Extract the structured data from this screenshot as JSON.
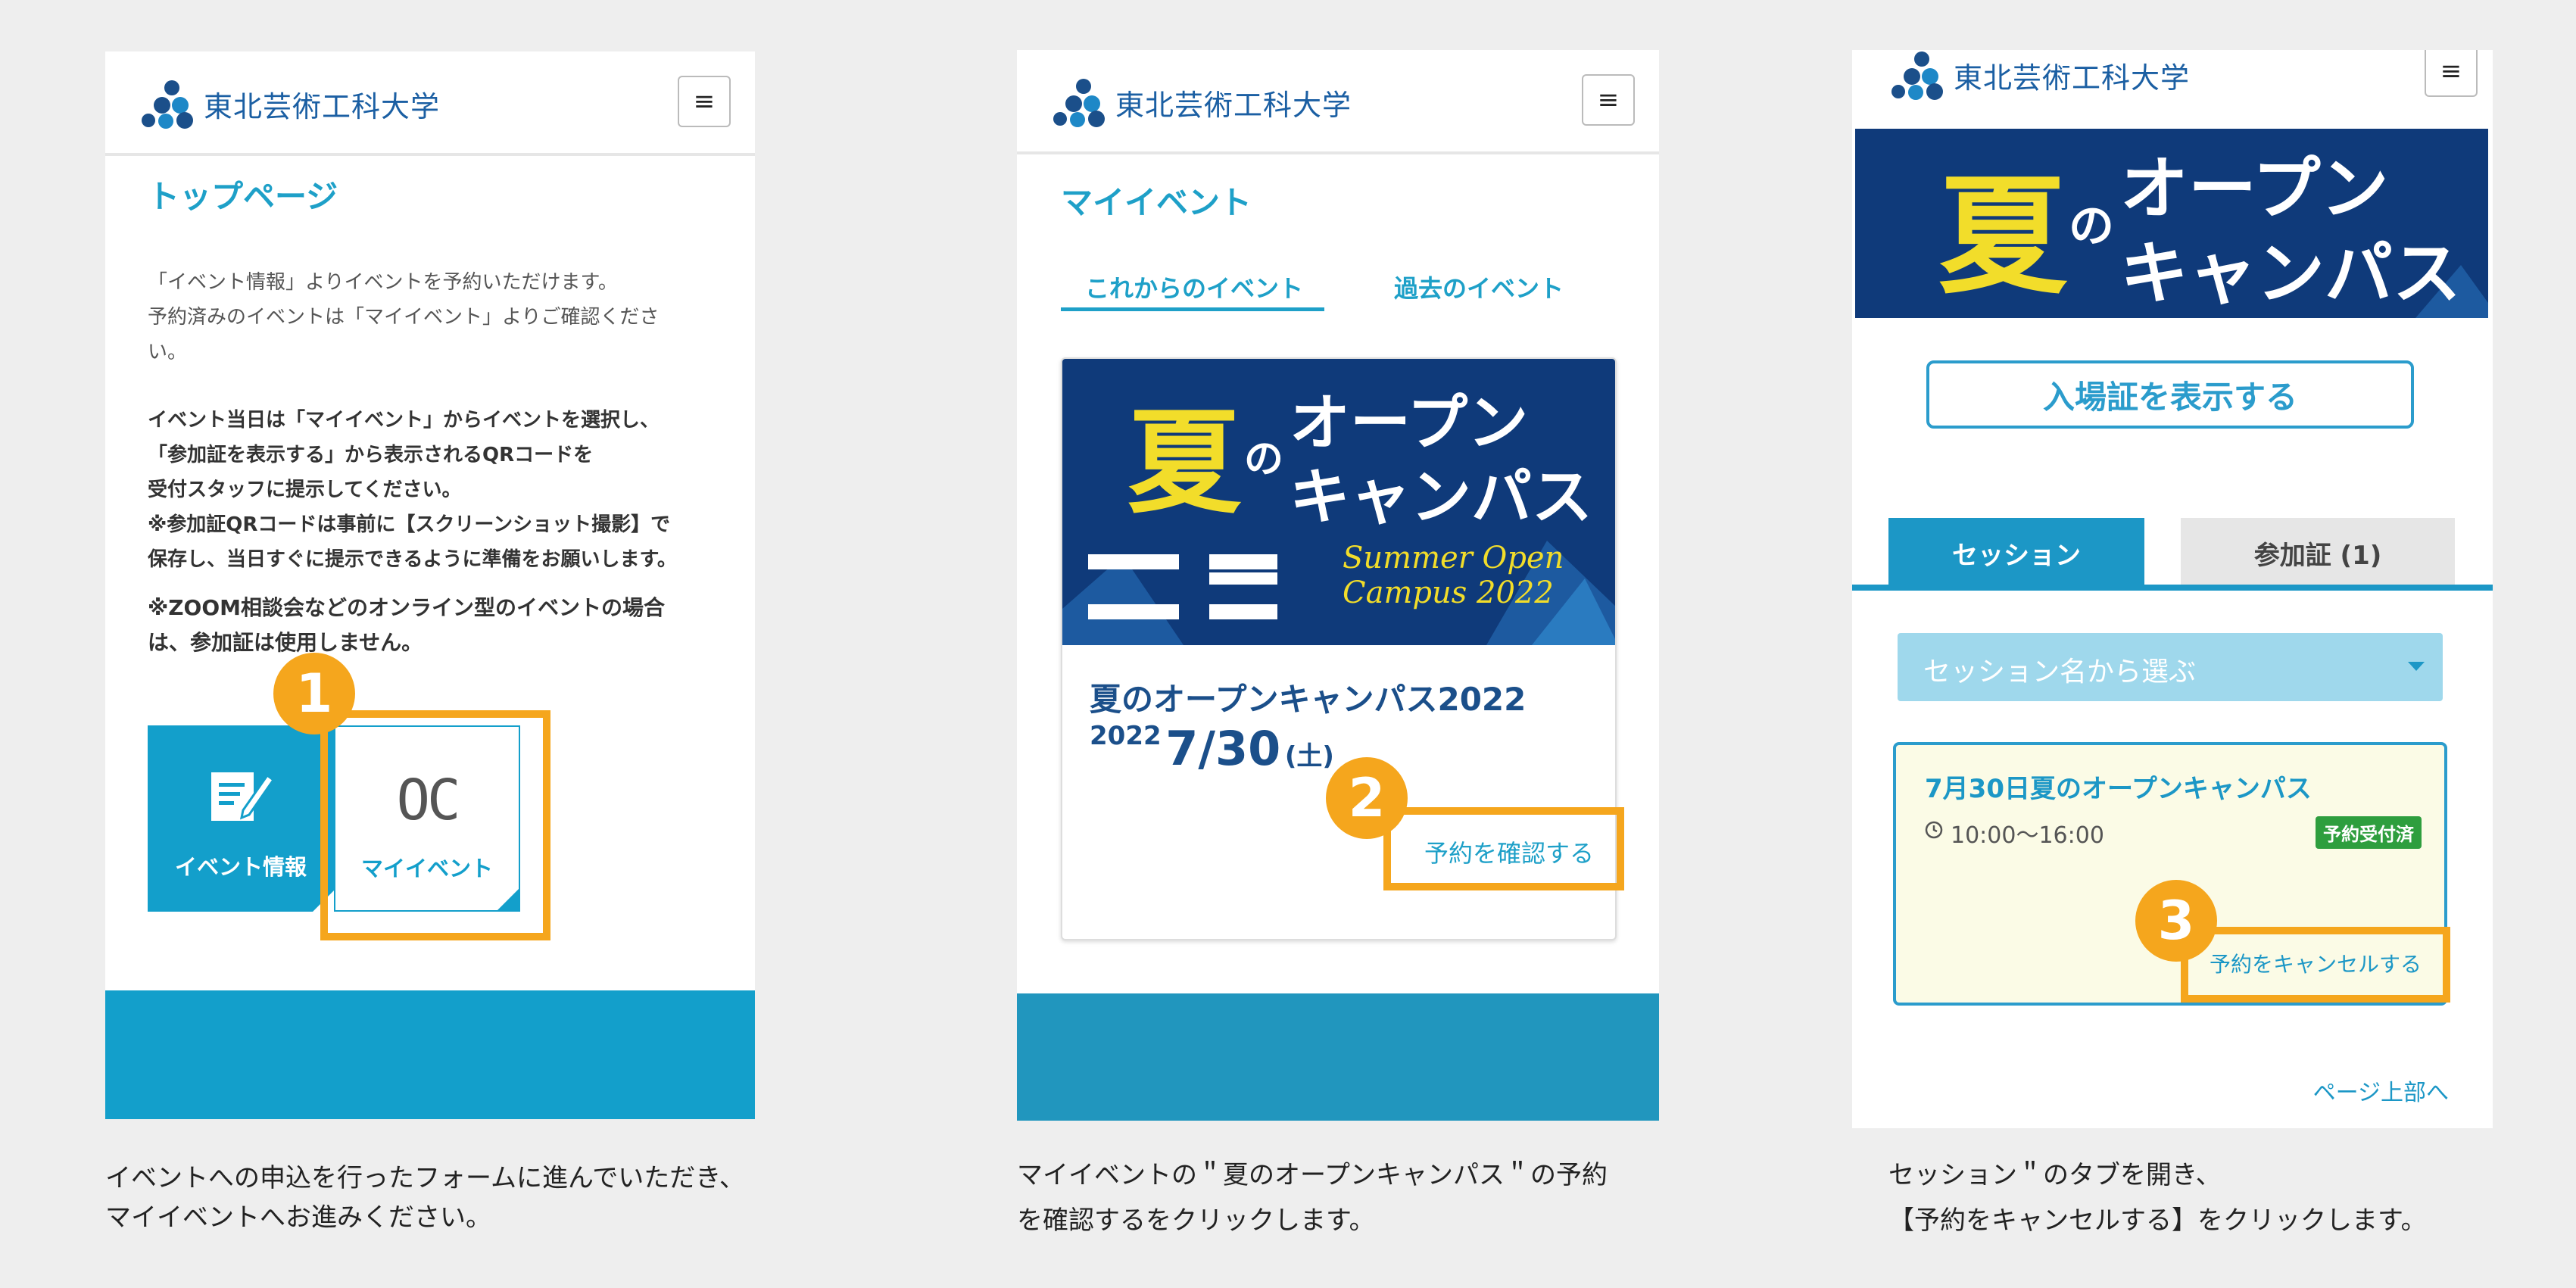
{
  "site": {
    "logo_text": "東北芸術工科大学",
    "menu_icon": "≡"
  },
  "panel1": {
    "title": "トップページ",
    "lines": [
      "「イベント情報」よりイベントを予約いただけます。",
      "予約済みのイベントは「マイイベント」よりご確認くださ",
      "い。"
    ],
    "bold_lines": [
      "イベント当日は「マイイベント」からイベントを選択し、",
      "「参加証を表示する」から表示されるQRコードを",
      "受付スタッフに提示してください。",
      "※参加証QRコードは事前に【スクリーンショット撮影】で",
      "保存し、当日すぐに提示できるように準備をお願いします。"
    ],
    "zoom_lines": [
      "※ZOOM相談会などのオンライン型のイベントの場合",
      "は、参加証は使用しません。"
    ],
    "event_tile_label": "イベント情報",
    "myevent_tile_label": "マイイベント",
    "myevent_icon_text": "OC",
    "step": "1"
  },
  "panel2": {
    "title": "マイイベント",
    "tab_upcoming": "これからのイベント",
    "tab_past": "過去のイベント",
    "banner": {
      "big": "夏",
      "no": "の",
      "line1": "オープン",
      "line2": "キャンパス",
      "script": "Summer Open Campus 2022"
    },
    "event_name": "夏のオープンキャンパス2022",
    "event_year": "2022",
    "event_date": "7/30",
    "event_dow": "(土)",
    "confirm_label": "予約を確認する",
    "step": "2"
  },
  "panel3": {
    "banner": {
      "big": "夏",
      "no": "の",
      "line1": "オープン",
      "line2": "キャンパス"
    },
    "show_pass_label": "入場証を表示する",
    "tab_session": "セッション",
    "tab_pass": "参加証 (1)",
    "select_placeholder": "セッション名から選ぶ",
    "session_title": "7月30日夏のオープンキャンパス",
    "session_time": "10:00〜16:00",
    "session_status": "予約受付済",
    "cancel_label": "予約をキャンセルする",
    "to_top": "ページ上部へ",
    "step": "3"
  },
  "captions": {
    "c1_l1": "イベントへの申込を行ったフォームに進んでいただき、",
    "c1_l2": "マイイベントへお進みください。",
    "c2_l1": "マイイベントの＂夏のオープンキャンパス＂の予約",
    "c2_l2": "を確認するをクリックします。",
    "c3_l1": "セッション＂のタブを開き、",
    "c3_l2": "【予約をキャンセルする】をクリックします。"
  },
  "colors": {
    "accent": "#1ea0c8",
    "highlight": "#f5a61d",
    "navy": "#0f3a7a",
    "status_green": "#2e9e3e"
  }
}
